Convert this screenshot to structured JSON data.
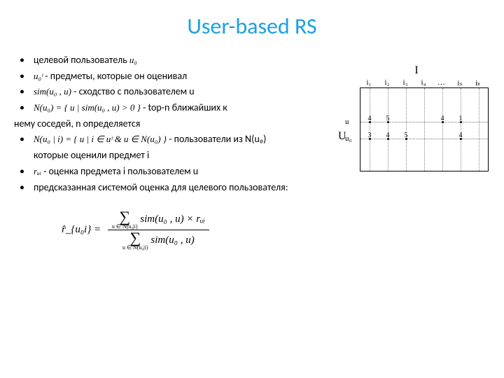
{
  "title": "User-based RS",
  "bullets": [
    {
      "pre": "целевой пользователь",
      "math": "u₀",
      "post": ""
    },
    {
      "pre": "",
      "math": "u₀ᶦ",
      "post": " - предметы, которые он оценивал"
    },
    {
      "pre": "",
      "math": "sim(u₀ , u)",
      "post": " - сходство с пользователем u"
    },
    {
      "pre": "",
      "math": "N(u₀) = { u | sim(u₀ , u) > 0 }",
      "post": " - top-n ближайших к"
    },
    {
      "pre": "",
      "math": "N(u₀ | i) = { u | i ∈ uᶦ & u ∈ N(u₀) }",
      "post": " - пользователи из N(u₀)"
    },
    {
      "pre": "",
      "math": "rᵤᵢ",
      "post": " - оценка предмета i пользователем u"
    },
    {
      "pre": "предсказанная системой оценка для целевого пользователя:",
      "math": "",
      "post": ""
    }
  ],
  "cont4": "нему соседей, n определяется",
  "cont5": "которые оценили предмет i",
  "formula": {
    "lhs": "r̂_{u₀i} =",
    "num_sub": "u ∈ N(u₀|i)",
    "num_expr": "sim(u₀ , u) × rᵤᵢ",
    "den_sub": "u ∈ N(u₀|i)",
    "den_expr": "sim(u₀ , u)"
  },
  "matrix": {
    "I": "I",
    "U": "U",
    "cols": [
      "i₁",
      "i₂",
      "i₃",
      "i₄",
      "…",
      "iₛ",
      "iₖ"
    ],
    "rows": [
      {
        "label": "u",
        "y": 48,
        "vals": {
          "0": "4",
          "1": "5",
          "4": "4",
          "5": "1"
        }
      },
      {
        "label": "u₀",
        "y": 72,
        "vals": {
          "0": "3",
          "1": "4",
          "2": "5",
          "5": "4"
        }
      }
    ]
  }
}
